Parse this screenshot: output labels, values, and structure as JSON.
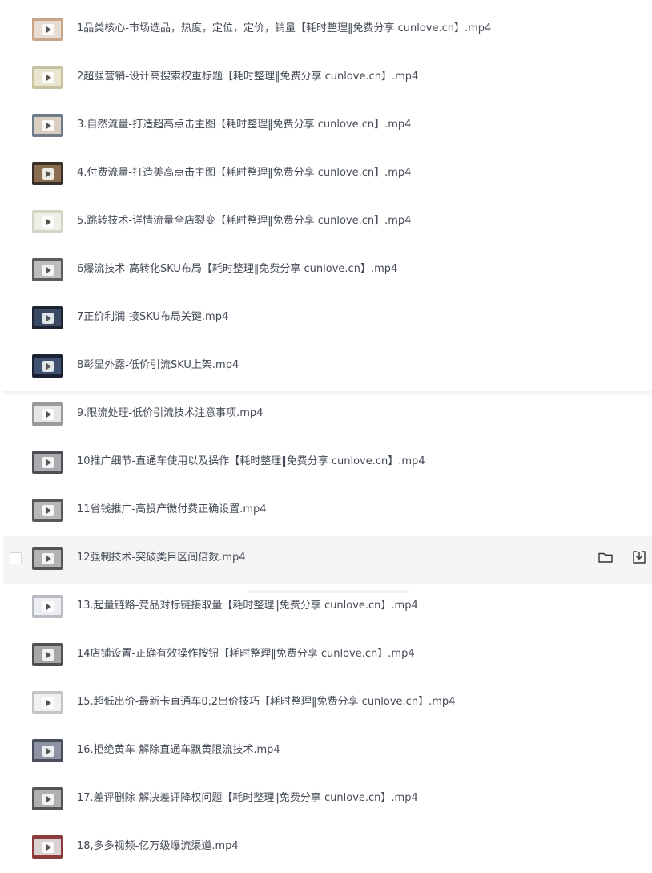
{
  "files": [
    {
      "name": "1品类核心-市场选品，热度，定位，定价，销量【耗时整理‖免费分享 cunlove.cn】.mp4",
      "thumb_bg": "#c9a588",
      "thumb_inner": "#e8ddd2"
    },
    {
      "name": "2超强营销-设计高搜索权重标题【耗时整理‖免费分享 cunlove.cn】.mp4",
      "thumb_bg": "#c8c2a0",
      "thumb_inner": "#e9e5cf"
    },
    {
      "name": "3.自然流量-打造超高点击主图【耗时整理‖免费分享 cunlove.cn】.mp4",
      "thumb_bg": "#6f7b8a",
      "thumb_inner": "#d9cfc0"
    },
    {
      "name": "4.付费流量-打造美高点击主图【耗时整理‖免费分享 cunlove.cn】.mp4",
      "thumb_bg": "#3a2f26",
      "thumb_inner": "#8a6d50"
    },
    {
      "name": "5.跳转技术-详情流量全店裂变【耗时整理‖免费分享 cunlove.cn】.mp4",
      "thumb_bg": "#cfd6c3",
      "thumb_inner": "#eef0e8"
    },
    {
      "name": "6爆流技术-高转化SKU布局【耗时整理‖免费分享 cunlove.cn】.mp4",
      "thumb_bg": "#5c5c5c",
      "thumb_inner": "#bdbdbd"
    },
    {
      "name": "7正价利润-接SKU布局关键.mp4",
      "thumb_bg": "#1d2330",
      "thumb_inner": "#3b4a63"
    },
    {
      "name": "8彰显外露-低价引流SKU上架.mp4",
      "thumb_bg": "#1a2233",
      "thumb_inner": "#3f5271"
    },
    {
      "name": "9.限流处理-低价引流技术注意事项.mp4",
      "thumb_bg": "#9a9a9a",
      "thumb_inner": "#e6e6e6"
    },
    {
      "name": "10推广细节-直通车使用以及操作【耗时整理‖免费分享 cunlove.cn】.mp4",
      "thumb_bg": "#4d4f55",
      "thumb_inner": "#a9abb0"
    },
    {
      "name": "11省钱推广-高投产微付费正确设置.mp4",
      "thumb_bg": "#595959",
      "thumb_inner": "#b8b8b8"
    },
    {
      "name": "12强制技术-突破类目区间倍数.mp4",
      "thumb_bg": "#555555",
      "thumb_inner": "#b3b3b3"
    },
    {
      "name": "13.起量链路-竞品对标链接取量【耗时整理‖免费分享 cunlove.cn】.mp4",
      "thumb_bg": "#b9bcc4",
      "thumb_inner": "#eceef2"
    },
    {
      "name": "14店铺设置-正确有效操作按钮【耗时整理‖免费分享 cunlove.cn】.mp4",
      "thumb_bg": "#505050",
      "thumb_inner": "#a6a6a6"
    },
    {
      "name": "15.超低出价-最新卡直通车0,2出价技巧【耗时整理‖免费分享 cunlove.cn】.mp4",
      "thumb_bg": "#c4c4c4",
      "thumb_inner": "#f0f0f0"
    },
    {
      "name": "16.拒绝黄车-解除直通车飘黄限流技术.mp4",
      "thumb_bg": "#4a4d5a",
      "thumb_inner": "#8e93a6"
    },
    {
      "name": "17.差评删除-解决差评降权问题【耗时整理‖免费分享 cunlove.cn】.mp4",
      "thumb_bg": "#545454",
      "thumb_inner": "#b0b0b0"
    },
    {
      "name": "18,多多视频-亿万级爆流渠道.mp4",
      "thumb_bg": "#8b3b3b",
      "thumb_inner": "#d9d2d2"
    }
  ],
  "hover_index": 11,
  "actions": {
    "folder_icon": "folder-icon",
    "download_icon": "download-icon"
  }
}
